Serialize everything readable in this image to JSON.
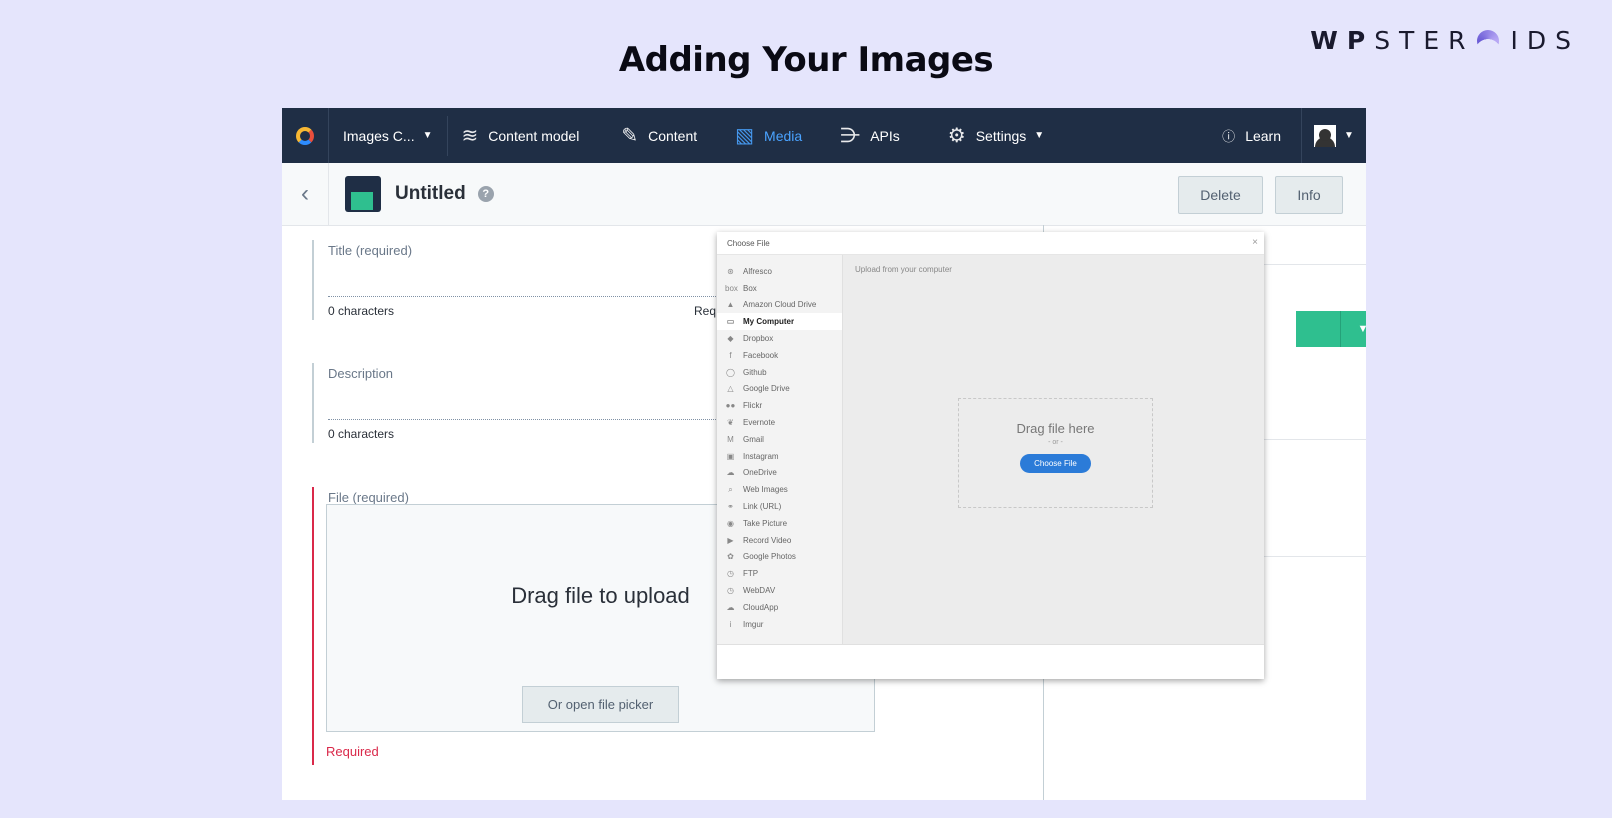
{
  "slide": {
    "title": "Adding Your Images",
    "brand": {
      "part1": "WP",
      "part2": "STER",
      "part3": "IDS"
    }
  },
  "topnav": {
    "space": "Images C...",
    "items": [
      {
        "label": "Content model",
        "icon": "layers-icon"
      },
      {
        "label": "Content",
        "icon": "content-edit-icon"
      },
      {
        "label": "Media",
        "icon": "media-image-icon",
        "active": true
      },
      {
        "label": "APIs",
        "icon": "api-icon"
      },
      {
        "label": "Settings",
        "icon": "gear-icon"
      }
    ],
    "learn": "Learn"
  },
  "entry": {
    "title": "Untitled",
    "delete_label": "Delete",
    "info_label": "Info"
  },
  "fields": {
    "title": {
      "label": "Title (required)",
      "count": "0 characters",
      "required_partial": "Req"
    },
    "description": {
      "label": "Description",
      "count": "0 characters"
    },
    "file": {
      "label": "File (required)",
      "drop_text": "Drag file to upload",
      "picker_label": "Or open file picker",
      "error": "Required"
    }
  },
  "picker_modal": {
    "title": "Choose File",
    "close": "×",
    "upload_note": "Upload from your computer",
    "drag_text": "Drag file here",
    "or_text": "- or -",
    "choose_button": "Choose File",
    "sources": [
      {
        "label": "Alfresco",
        "icon": "⊛"
      },
      {
        "label": "Box",
        "icon": "box"
      },
      {
        "label": "Amazon Cloud Drive",
        "icon": "▲"
      },
      {
        "label": "My Computer",
        "icon": "▭",
        "selected": true
      },
      {
        "label": "Dropbox",
        "icon": "◆"
      },
      {
        "label": "Facebook",
        "icon": "f"
      },
      {
        "label": "Github",
        "icon": "◯"
      },
      {
        "label": "Google Drive",
        "icon": "△"
      },
      {
        "label": "Flickr",
        "icon": "●●"
      },
      {
        "label": "Evernote",
        "icon": "❦"
      },
      {
        "label": "Gmail",
        "icon": "M"
      },
      {
        "label": "Instagram",
        "icon": "▣"
      },
      {
        "label": "OneDrive",
        "icon": "☁"
      },
      {
        "label": "Web Images",
        "icon": "⌕"
      },
      {
        "label": "Link (URL)",
        "icon": "⚭"
      },
      {
        "label": "Take Picture",
        "icon": "◉"
      },
      {
        "label": "Record Video",
        "icon": "▶"
      },
      {
        "label": "Google Photos",
        "icon": "✿"
      },
      {
        "label": "FTP",
        "icon": "◷"
      },
      {
        "label": "WebDAV",
        "icon": "◷"
      },
      {
        "label": "CloudApp",
        "icon": "☁"
      },
      {
        "label": "Imgur",
        "icon": "i"
      }
    ]
  }
}
